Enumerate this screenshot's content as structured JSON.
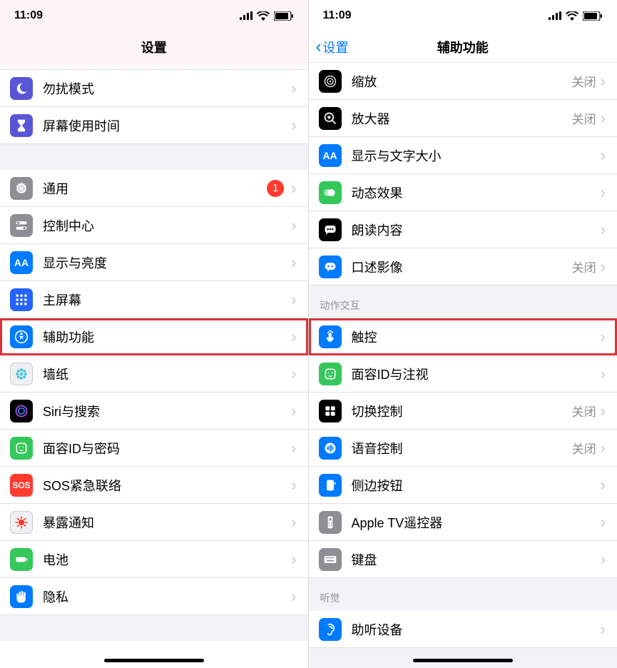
{
  "status": {
    "time": "11:09"
  },
  "left": {
    "title": "设置",
    "rows": [
      {
        "id": "dnd",
        "label": "勿扰模式",
        "icon": "moon-icon",
        "bg": "bg-indigo"
      },
      {
        "id": "screentime",
        "label": "屏幕使用时间",
        "icon": "hourglass-icon",
        "bg": "bg-indigo"
      },
      {
        "gap": true
      },
      {
        "id": "general",
        "label": "通用",
        "icon": "gear-icon",
        "bg": "bg-gray",
        "badge": "1"
      },
      {
        "id": "control",
        "label": "控制中心",
        "icon": "switches-icon",
        "bg": "bg-gray"
      },
      {
        "id": "display",
        "label": "显示与亮度",
        "icon": "aa-icon",
        "bg": "bg-blue"
      },
      {
        "id": "home",
        "label": "主屏幕",
        "icon": "grid-icon",
        "bg": "bg-grid"
      },
      {
        "id": "accessibility",
        "label": "辅助功能",
        "icon": "accessibility-icon",
        "bg": "bg-blue",
        "highlighted": true
      },
      {
        "id": "wallpaper",
        "label": "墙纸",
        "icon": "flower-icon",
        "bg": "bg-lightgray"
      },
      {
        "id": "siri",
        "label": "Siri与搜索",
        "icon": "siri-icon",
        "bg": "bg-black"
      },
      {
        "id": "faceid",
        "label": "面容ID与密码",
        "icon": "face-icon",
        "bg": "bg-green"
      },
      {
        "id": "sos",
        "label": "SOS紧急联络",
        "icon": "sos-text",
        "bg": "bg-red"
      },
      {
        "id": "exposure",
        "label": "暴露通知",
        "icon": "covid-icon",
        "bg": "bg-lightgray"
      },
      {
        "id": "battery",
        "label": "电池",
        "icon": "battery-icon",
        "bg": "bg-green"
      },
      {
        "id": "privacy",
        "label": "隐私",
        "icon": "hand-icon",
        "bg": "bg-blue"
      },
      {
        "gap": true
      }
    ]
  },
  "right": {
    "back": "设置",
    "title": "辅助功能",
    "sections": [
      {
        "rows": [
          {
            "id": "zoom",
            "label": "缩放",
            "value": "关闭",
            "icon": "target-icon",
            "bg": "bg-black"
          },
          {
            "id": "magnifier",
            "label": "放大器",
            "value": "关闭",
            "icon": "magnify-plus-icon",
            "bg": "bg-black"
          },
          {
            "id": "textsize",
            "label": "显示与文字大小",
            "value": "",
            "icon": "aa-icon",
            "bg": "bg-blue"
          },
          {
            "id": "motion",
            "label": "动态效果",
            "value": "",
            "icon": "motion-icon",
            "bg": "bg-green"
          },
          {
            "id": "spoken",
            "label": "朗读内容",
            "value": "",
            "icon": "speech-icon",
            "bg": "bg-black"
          },
          {
            "id": "audio-desc",
            "label": "口述影像",
            "value": "关闭",
            "icon": "chat-icon",
            "bg": "bg-blue"
          }
        ]
      },
      {
        "header": "动作交互",
        "rows": [
          {
            "id": "touch",
            "label": "触控",
            "value": "",
            "icon": "touch-icon",
            "bg": "bg-blue",
            "highlighted": true
          },
          {
            "id": "face-attention",
            "label": "面容ID与注视",
            "value": "",
            "icon": "face-icon",
            "bg": "bg-green"
          },
          {
            "id": "switch-control",
            "label": "切换控制",
            "value": "关闭",
            "icon": "switch-grid-icon",
            "bg": "bg-black"
          },
          {
            "id": "voice-control",
            "label": "语音控制",
            "value": "关闭",
            "icon": "voice-icon",
            "bg": "bg-blue"
          },
          {
            "id": "side-button",
            "label": "侧边按钮",
            "value": "",
            "icon": "side-button-icon",
            "bg": "bg-blue"
          },
          {
            "id": "apple-tv",
            "label": "Apple TV遥控器",
            "value": "",
            "icon": "remote-icon",
            "bg": "bg-gray"
          },
          {
            "id": "keyboard",
            "label": "键盘",
            "value": "",
            "icon": "keyboard-icon",
            "bg": "bg-gray"
          }
        ]
      },
      {
        "header": "听觉",
        "rows": [
          {
            "id": "hearing",
            "label": "助听设备",
            "value": "",
            "icon": "ear-icon",
            "bg": "bg-blue"
          }
        ]
      }
    ]
  }
}
